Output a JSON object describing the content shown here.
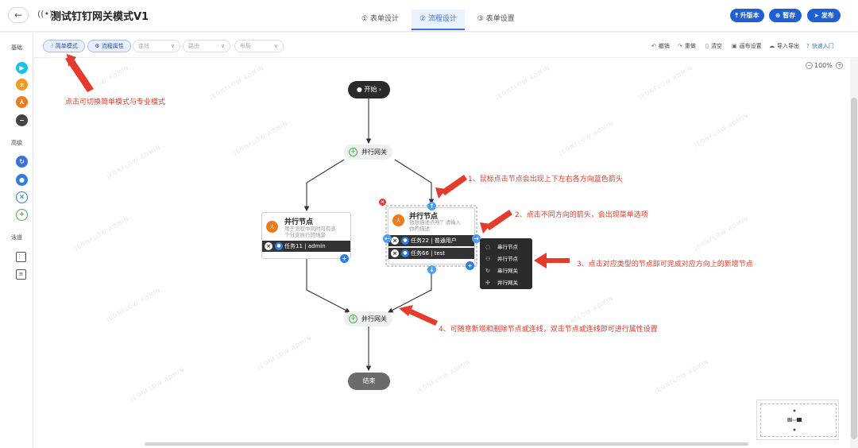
{
  "header": {
    "back_icon": "back-arrow-icon",
    "title_icon": "broadcast-icon",
    "title": "测试钉钉网关模式V1",
    "steps": [
      "① 表单设计",
      "② 流程设计",
      "③ 表单设置"
    ],
    "active_step": 1,
    "buttons": {
      "upgrade": "升版本",
      "save": "暂存",
      "publish": "发布"
    },
    "accent_color": "#1f5fd6"
  },
  "sidebar": {
    "sections": {
      "basic": "基础",
      "advanced": "高级",
      "lane": "泳道"
    },
    "basic_icon_colors": [
      "#19c3e6",
      "#f39a1e",
      "#f07a1a",
      "#444444"
    ],
    "advanced_icon_colors": [
      "#3b6fe0",
      "#2f7de1",
      "#2f7de1",
      "#4caf50"
    ]
  },
  "toolbar": {
    "simple_mode": "简单模式",
    "flow_props": "流程属性",
    "select_line": "连线",
    "select_route": "路由",
    "select_layout": "布局",
    "undo": "撤销",
    "redo": "重做",
    "clear": "清空",
    "canvas_settings": "画布设置",
    "import_export": "导入导出",
    "quick_start": "快速入门"
  },
  "canvas": {
    "zoom": "100%",
    "watermark": "JEONFLOW ADMIN",
    "start_label": "开始",
    "end_label": "结束",
    "gateway_top": "并行网关",
    "gateway_bottom": "并行网关",
    "left_card": {
      "title": "并行节点",
      "desc_line1": "用于流程中同时可有多",
      "desc_line2": "个分支执行的场景",
      "task": "任务11 | admin"
    },
    "right_card": {
      "title": "并行节点",
      "desc_line1": "你想描述点啥？请输入",
      "desc_line2": "你的描述",
      "task1": "任务22 | 普通用户",
      "task2": "任务66 | test"
    },
    "menu": [
      "串行节点",
      "并行节点",
      "串行网关",
      "并行网关"
    ]
  },
  "annotations": {
    "mode_hint": "点击可切换简单模式与专业模式",
    "tip1": "1、鼠标点击节点会出现上下左右各方向蓝色箭头",
    "tip2": "2、点击不同方向的箭头，会出现菜单选项",
    "tip3": "3、点击对应类型的节点即可完成对应方向上的新增节点",
    "tip4": "4、可随意新增和删除节点或连线，双击节点或连线即可进行属性设置",
    "annot_color": "#e53b2c"
  }
}
